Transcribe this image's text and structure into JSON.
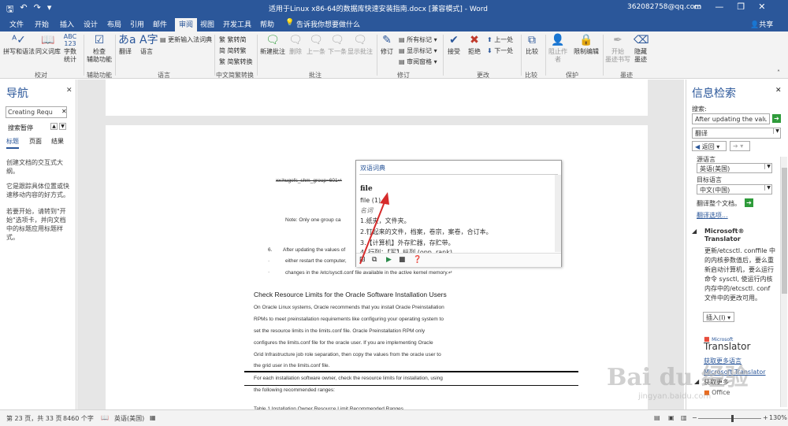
{
  "titlebar": {
    "title": "适用于Linux x86-64的数据库快速安装指南.docx [兼容模式] - Word",
    "user": "362082758@qq.com",
    "icons": [
      "save-icon",
      "undo-icon",
      "redo-icon",
      "minimize-icon",
      "restore-icon",
      "close-icon",
      "ribbon-display-icon"
    ]
  },
  "tabs": {
    "file": "文件",
    "home": "开始",
    "insert": "插入",
    "design": "设计",
    "layout": "布局",
    "references": "引用",
    "mailings": "邮件",
    "review": "审阅",
    "view": "视图",
    "developer": "开发工具",
    "help": "帮助",
    "tellme": "告诉我你想要做什么",
    "share": "共享"
  },
  "ribbon": {
    "spelling": "拼写和语法",
    "thesaurus": "同义词库",
    "wordcount_1": "字数",
    "wordcount_2": "统计",
    "check_1": "检查",
    "check_2": "辅助功能",
    "translate": "翻译",
    "language": "语言",
    "update_ime": "更新输入法词典",
    "trad_to_simp": "繁转简",
    "simp_to_trad": "简转繁",
    "convert": "简繁转换",
    "new_comment": "新建批注",
    "delete": "删除",
    "previous": "上一条",
    "next": "下一条",
    "show_comments": "显示批注",
    "track": "修订",
    "all_markup": "所有标记",
    "show_markup": "显示标记",
    "review_pane": "审阅窗格",
    "accept": "接受",
    "reject": "拒绝",
    "prev_change": "上一处",
    "next_change": "下一处",
    "compare": "比较",
    "block_authors_1": "阻止作",
    "block_authors_2": "者",
    "restrict": "限制编辑",
    "start_ink_1": "开始",
    "start_ink_2": "墨迹书写",
    "hide_ink_1": "隐藏",
    "hide_ink_2": "墨迹",
    "groups": {
      "proofing": "校对",
      "accessibility": "辅助功能",
      "language": "语言",
      "chinese": "中文简繁转换",
      "comments": "批注",
      "tracking": "修订",
      "changes": "更改",
      "compare": "比较",
      "protect": "保护",
      "ink": "墨迹"
    }
  },
  "navpane": {
    "title": "导航",
    "search_value": "Creating Requ",
    "search_label": "搜索暂停",
    "tabs": {
      "headings": "标题",
      "pages": "页面",
      "results": "结果"
    },
    "para1": "创建文档的交互式大纲。",
    "para2": "它是跟踪具体位置或快速移动内容的好方式。",
    "para3": "若要开始，请转到\"开始\"选项卡，并向文档中的标题应用标题样式。"
  },
  "document": {
    "line_group": "xx:hugefs_shm_group=601↵",
    "note": "Note:    Only one group ca",
    "item6_num": "6.",
    "item6": "After updating the values of",
    "item6_b": "either restart the computer,",
    "item6_c": "changes in the /etc/sysctl.conf file available in the active kernel memory.↵",
    "heading": "Check Resource Limits for the Oracle Software Installation Users",
    "p1": "On Oracle Linux systems, Oracle recommends that you install Oracle Preinstallation",
    "p2": "RPMs to meet preinstallation requirements like configuring your operating system to",
    "p3": "set the resource limits in the limits.conf file. Oracle Preinstallation RPM only",
    "p4": "configures the limits.conf file for the oracle user. If you are implementing Oracle",
    "p5": "Grid Infrastructure job role separation, then copy the values from the oracle user to",
    "p6": "the grid user in the limits.conf file.",
    "p7": "For each installation software owner, check the resource limits for installation, using",
    "p8": "the following recommended ranges:",
    "table_caption": "Table 1      Installation Owner Resource Limit Recommended Ranges"
  },
  "popup": {
    "title": "双语词典",
    "word": "file",
    "line1": "file (1)",
    "pos": "名词",
    "def1": "1.纸夹，文件夹。",
    "def2": "2.钉起来的文件，档案，卷宗，案卷，合订本。",
    "def3": "3.【计算机】外存贮器，存贮带。",
    "def4": "4. 行列；【军】纵列 (opp. rank)"
  },
  "rightpane": {
    "title": "信息检索",
    "search_label": "搜索:",
    "search_value": "After updating the value",
    "service": "翻译",
    "back": "返回",
    "source_label": "源语言",
    "source_value": "英语(美国)",
    "target_label": "目标语言",
    "target_value": "中文(中国)",
    "translate_doc": "翻译整个文档。",
    "translate_options": "翻译选项...",
    "provider_1": "Microsoft®",
    "provider_2": "Translator",
    "result": "更新/etcsctl. conffile 中的内核参数值后，要么重新启动计算机，要么运行命令 sysctl, 使运行内核内存中的/etcsctl. conf 文件中的更改可用。",
    "insert": "插入(I)",
    "brand_1": "Microsoft",
    "brand_2": "Translator",
    "more": "获取更多语言",
    "ms_translator": "Microsoft Translator",
    "more2": "获取更多",
    "office": "Office"
  },
  "statusbar": {
    "page": "第 23 页，共 33 页",
    "words": "8460 个字",
    "lang": "英语(美国)",
    "zoom": "130%"
  },
  "watermark": {
    "text1": "Bai du 经验",
    "text2": "jingyan.baidu.com"
  }
}
